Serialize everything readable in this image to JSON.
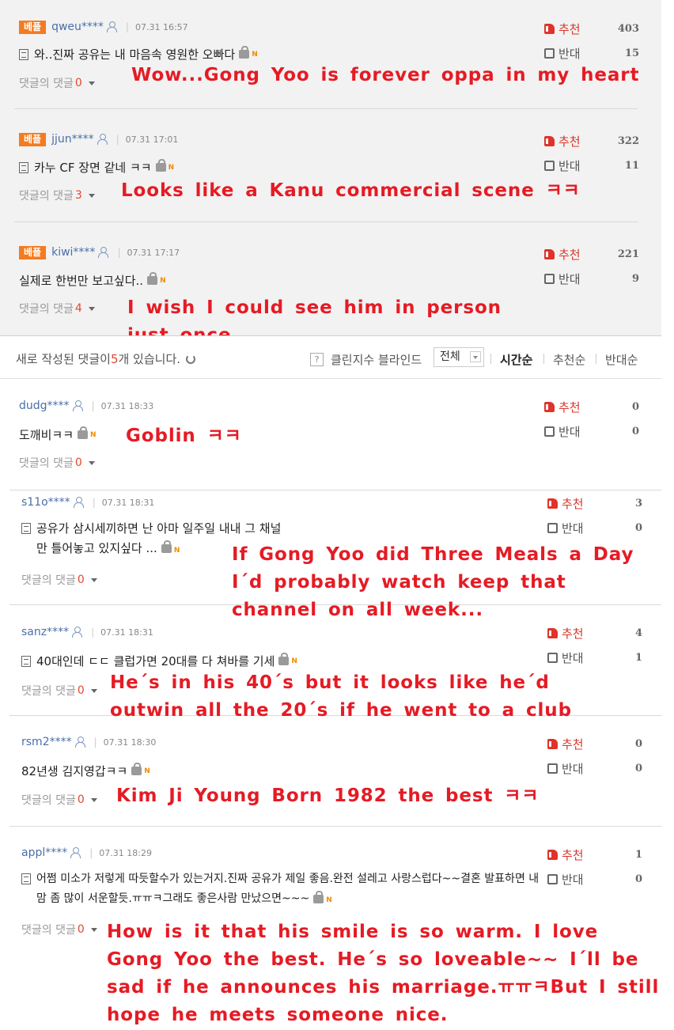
{
  "labels": {
    "best_badge": "베플",
    "recommend": "추천",
    "oppose": "반대",
    "reply_label": "댓글의 댓글"
  },
  "best_comments": [
    {
      "nick": "qweu****",
      "time": "07.31 16:57",
      "text": "와..진짜 공유는 내 마음속 영원한 오빠다",
      "reply_count": "0",
      "recommend": "403",
      "oppose": "15",
      "translation": "Wow...Gong Yoo is forever oppa in my heart"
    },
    {
      "nick": "jjun****",
      "time": "07.31 17:01",
      "text": "카누 CF 장면 같네 ㅋㅋ",
      "reply_count": "3",
      "recommend": "322",
      "oppose": "11",
      "translation": "Looks like a Kanu commercial scene ㅋㅋ"
    },
    {
      "nick": "kiwi****",
      "time": "07.31 17:17",
      "text": "실제로 한번만 보고싶다..",
      "reply_count": "4",
      "recommend": "221",
      "oppose": "9",
      "translation": "I wish I could see him in person just once..."
    }
  ],
  "toolbar": {
    "notice_prefix": "새로 작성된 댓글이 ",
    "notice_count": "5",
    "notice_suffix": "개 있습니다.",
    "help": "?",
    "clean_label": "클린지수 블라인드",
    "filter_value": "전체",
    "sort_time": "시간순",
    "sort_recommend": "추천순",
    "sort_oppose": "반대순"
  },
  "comments": [
    {
      "nick": "dudg****",
      "time": "07.31 18:33",
      "text": "도깨비ㅋㅋ",
      "reply_count": "0",
      "recommend": "0",
      "oppose": "0",
      "translation": "Goblin ㅋㅋ"
    },
    {
      "nick": "s11o****",
      "time": "07.31 18:31",
      "text": "공유가 삼시세끼하면 난 아마 일주일 내내 그 채널만 틀어놓고 있지싶다 ...",
      "reply_count": "0",
      "recommend": "3",
      "oppose": "0",
      "translation": "If Gong Yoo did Three Meals a Day I´d probably watch keep that channel on all week..."
    },
    {
      "nick": "sanz****",
      "time": "07.31 18:31",
      "text": "40대인데 ㄷㄷ 클럽가면 20대를 다 쳐바를 기세",
      "reply_count": "0",
      "recommend": "4",
      "oppose": "1",
      "translation": "He´s in his 40´s but it looks like he´d outwin all the 20´s if he went to a club"
    },
    {
      "nick": "rsm2****",
      "time": "07.31 18:30",
      "text": "82년생 김지영갑ㅋㅋ",
      "reply_count": "0",
      "recommend": "0",
      "oppose": "0",
      "translation": "Kim Ji Young Born 1982 the best ㅋㅋ"
    },
    {
      "nick": "appl****",
      "time": "07.31 18:29",
      "text": "어쩜 미소가 저렇게 따듯할수가 있는거지.진짜 공유가 제일 좋음.완전 설레고 사랑스럽다~~결혼 발표하면 내 맘 좀 많이 서운할듯.ㅠㅠㅋ그래도 좋은사람 만났으면~~~",
      "reply_count": "0",
      "recommend": "1",
      "oppose": "0",
      "translation": "How is it that his smile is so warm. I love Gong Yoo the best. He´s so loveable~~ I´ll be sad if he announces his marriage.ㅠㅠㅋBut I still hope he meets someone nice."
    }
  ]
}
